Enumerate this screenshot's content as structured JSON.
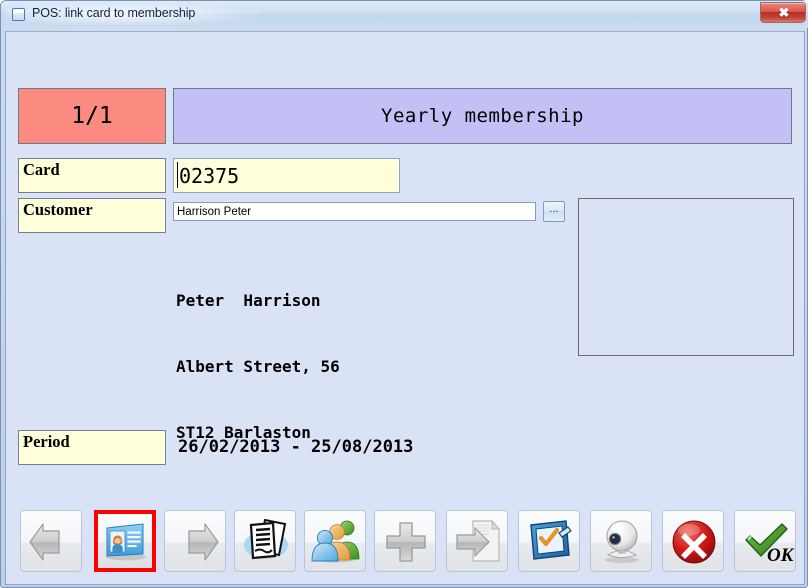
{
  "window": {
    "title": "POS: link card to membership",
    "icon": "window-icon",
    "close_label": "✖"
  },
  "colors": {
    "window_background": "#d9e3f5",
    "title_bar": "#cfe0f3",
    "counter_badge": "#fb8a80",
    "banner": "#c3c0f6",
    "label_field": "#ffffdc",
    "card_input": "#ffffdc",
    "selection_highlight": "#ff0000",
    "ok_green": "#3f9c35",
    "cancel_red": "#c11414"
  },
  "form": {
    "counter": "1/1",
    "membership_type": "Yearly membership",
    "card": {
      "label": "Card",
      "value": "02375",
      "placeholder": ""
    },
    "customer": {
      "label": "Customer",
      "value": "Harrison Peter",
      "placeholder": "",
      "browse_label": "..."
    },
    "address_lines": [
      "Peter  Harrison",
      "Albert Street, 56",
      "ST12 Barlaston"
    ],
    "photo_panel": {
      "content": ""
    },
    "period": {
      "label": "Period",
      "value": "26/02/2013 - 25/08/2013"
    }
  },
  "toolbar": {
    "buttons": [
      {
        "name": "previous-button",
        "icon": "arrow-left-icon",
        "label": "",
        "selected": false
      },
      {
        "name": "id-card-button",
        "icon": "id-card-icon",
        "label": "",
        "selected": true
      },
      {
        "name": "next-button",
        "icon": "arrow-right-icon",
        "label": "",
        "selected": false
      },
      {
        "name": "documents-button",
        "icon": "documents-icon",
        "label": "",
        "selected": false
      },
      {
        "name": "customers-button",
        "icon": "people-group-icon",
        "label": "",
        "selected": false
      },
      {
        "name": "add-button",
        "icon": "plus-icon",
        "label": "",
        "selected": false
      },
      {
        "name": "export-button",
        "icon": "arrow-to-document-icon",
        "label": "",
        "selected": false
      },
      {
        "name": "signature-button",
        "icon": "check-tablet-icon",
        "label": "",
        "selected": false
      },
      {
        "name": "webcam-button",
        "icon": "webcam-icon",
        "label": "",
        "selected": false
      },
      {
        "name": "cancel-button",
        "icon": "red-x-circle-icon",
        "label": "",
        "selected": false
      },
      {
        "name": "ok-button",
        "icon": "green-check-icon",
        "label": "OK",
        "selected": false
      }
    ]
  }
}
